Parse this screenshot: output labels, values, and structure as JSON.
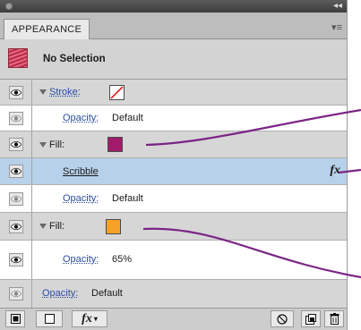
{
  "panel": {
    "tab_label": "APPEARANCE",
    "header_label": "No Selection"
  },
  "rows": [
    {
      "type": "attr",
      "label": "Stroke:",
      "swatch": "none"
    },
    {
      "type": "opacity",
      "label": "Opacity:",
      "value": "Default"
    },
    {
      "type": "attr",
      "label": "Fill:",
      "swatch": "#a31c6b"
    },
    {
      "type": "effect",
      "label": "Scribble",
      "fx": "fx"
    },
    {
      "type": "opacity",
      "label": "Opacity:",
      "value": "Default"
    },
    {
      "type": "attr",
      "label": "Fill:",
      "swatch": "#f7a128"
    },
    {
      "type": "opacity",
      "label": "Opacity:",
      "value": "65%"
    },
    {
      "type": "opacity",
      "label": "Opacity:",
      "value": "Default"
    }
  ],
  "bottom_toolbar": [
    "new-art-maintain-icon",
    "new-art-basic-icon",
    "fx-menu-icon",
    "clear-appearance-icon",
    "duplicate-item-icon",
    "trash-icon"
  ],
  "colors": {
    "callout_line": "#7b2585",
    "highlight_row": "#b8d1ea"
  }
}
